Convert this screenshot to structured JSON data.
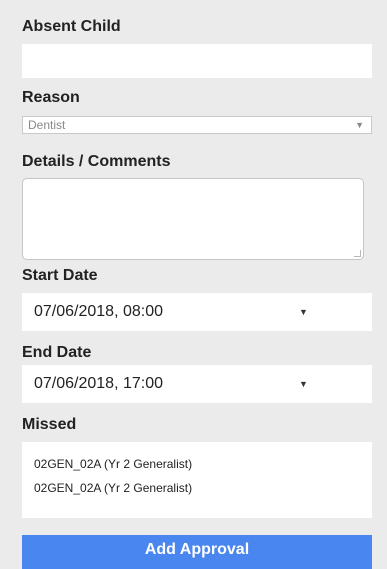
{
  "form": {
    "absent_child": {
      "label": "Absent Child",
      "value": ""
    },
    "reason": {
      "label": "Reason",
      "selected": "Dentist",
      "arrow_icon": "triangle-down-icon"
    },
    "details": {
      "label": "Details / Comments",
      "value": ""
    },
    "start_date": {
      "label": "Start Date",
      "value": "07/06/2018, 08:00",
      "arrow_icon": "triangle-down-icon"
    },
    "end_date": {
      "label": "End Date",
      "value": "07/06/2018, 17:00",
      "arrow_icon": "triangle-down-icon"
    },
    "missed": {
      "label": "Missed",
      "items": [
        "02GEN_02A (Yr 2 Generalist)",
        "02GEN_02A (Yr 2 Generalist)"
      ]
    },
    "submit_label": "Add Approval"
  },
  "colors": {
    "background": "#ebebeb",
    "field_background": "#ffffff",
    "button_background": "#4a86f0",
    "button_text": "#ffffff"
  }
}
